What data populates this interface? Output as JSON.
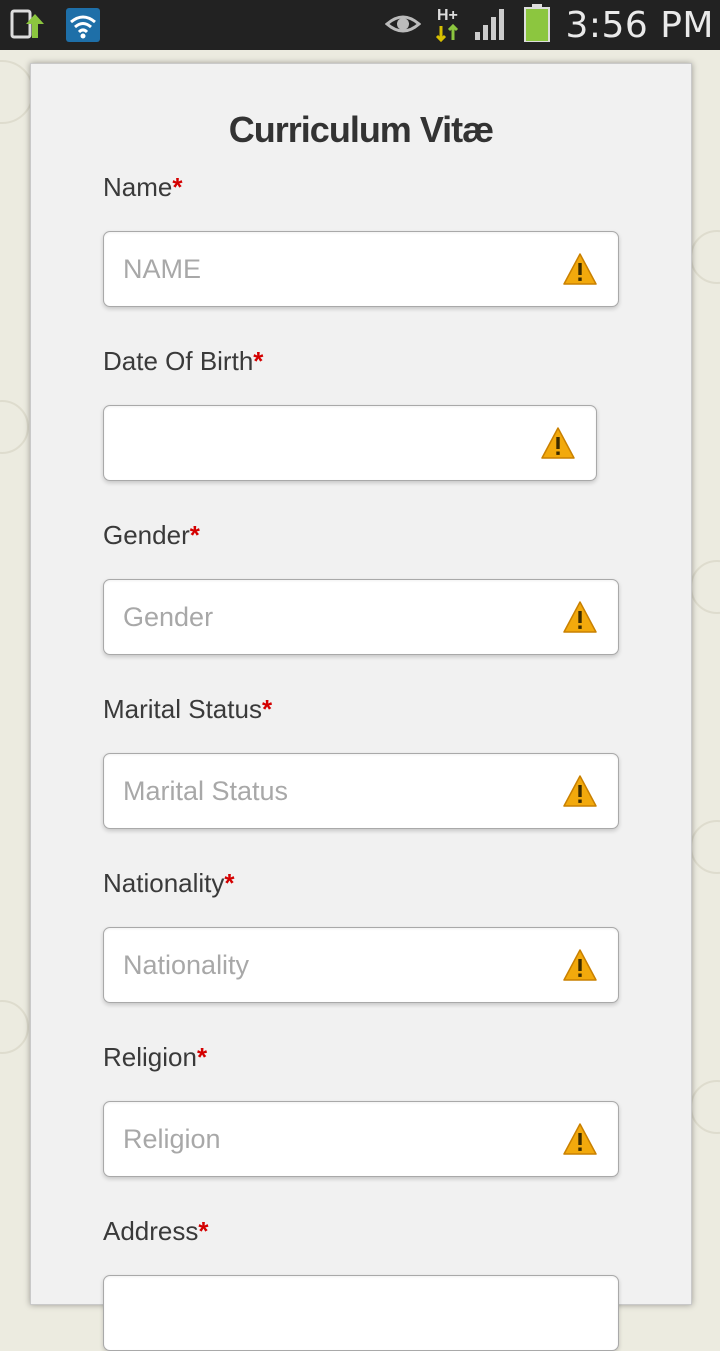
{
  "status_bar": {
    "time": "3:56 PM",
    "network": "H+"
  },
  "form": {
    "title": "Curriculum Vitæ",
    "required_mark": "*",
    "fields": [
      {
        "label": "Name",
        "placeholder": "NAME"
      },
      {
        "label": "Date Of Birth",
        "placeholder": ""
      },
      {
        "label": "Gender",
        "placeholder": "Gender"
      },
      {
        "label": "Marital Status",
        "placeholder": "Marital Status"
      },
      {
        "label": "Nationality",
        "placeholder": "Nationality"
      },
      {
        "label": "Religion",
        "placeholder": "Religion"
      },
      {
        "label": "Address",
        "placeholder": ""
      }
    ]
  },
  "colors": {
    "required": "#d40000",
    "warning": "#f2a90c",
    "status_bar": "#222222",
    "card": "#f1f1f1"
  },
  "icons": [
    "download-icon",
    "wifi-icon",
    "eye-icon",
    "data-arrows-icon",
    "signal-icon",
    "battery-icon",
    "warning-icon"
  ]
}
